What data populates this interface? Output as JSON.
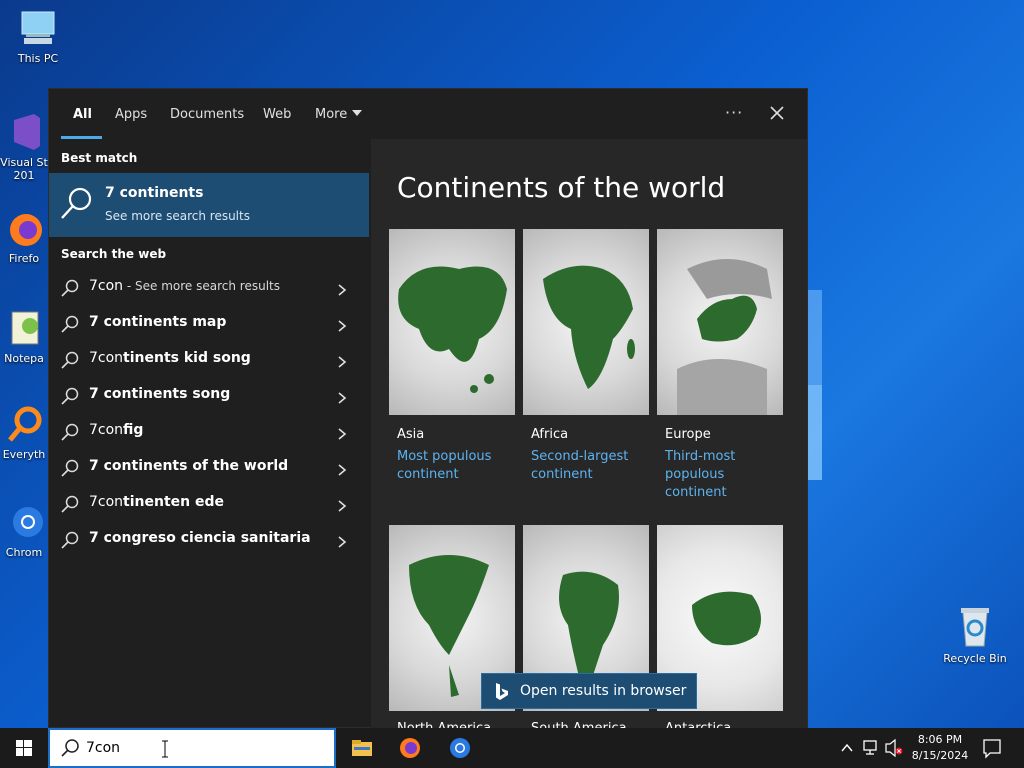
{
  "desktop": {
    "icons": [
      {
        "label": "This PC"
      },
      {
        "label": "Visual St\n201"
      },
      {
        "label": "Firefo"
      },
      {
        "label": "Notepa"
      },
      {
        "label": "Everyth"
      },
      {
        "label": "Chrom"
      }
    ],
    "recycle_bin": "Recycle Bin"
  },
  "search_panel": {
    "tabs": [
      "All",
      "Apps",
      "Documents",
      "Web",
      "More"
    ],
    "active_tab": "All",
    "more_options_icon": "ellipsis-icon",
    "close_icon": "close-icon",
    "best_match_label": "Best match",
    "best_match": {
      "title": "7 continents",
      "subtitle": "See more search results"
    },
    "search_web_label": "Search the web",
    "web_results": [
      {
        "prefix": "7con",
        "bold": "",
        "suffix": " - See more search results"
      },
      {
        "prefix": "7 continents map",
        "bold": "",
        "suffix": ""
      },
      {
        "prefix": "7con",
        "bold": "tinents kid song",
        "suffix": ""
      },
      {
        "prefix": "7 continents song",
        "bold": "",
        "suffix": ""
      },
      {
        "prefix": "7con",
        "bold": "fig",
        "suffix": ""
      },
      {
        "prefix": "7 continents of the world",
        "bold": "",
        "suffix": ""
      },
      {
        "prefix": "7con",
        "bold": "tinenten ede",
        "suffix": ""
      },
      {
        "prefix": "7 congreso ciencia sanitaria",
        "bold": "",
        "suffix": ""
      }
    ],
    "preview": {
      "title": "Continents of the world",
      "cards": [
        {
          "name": "Asia",
          "desc": "Most populous continent"
        },
        {
          "name": "Africa",
          "desc": "Second-largest continent"
        },
        {
          "name": "Europe",
          "desc": "Third-most populous continent"
        },
        {
          "name": "North America",
          "desc": ""
        },
        {
          "name": "South America",
          "desc": ""
        },
        {
          "name": "Antarctica",
          "desc": ""
        }
      ],
      "open_button": "Open results in browser"
    }
  },
  "taskbar": {
    "search_value": "7con",
    "time": "8:06 PM",
    "date": "8/15/2024"
  },
  "colors": {
    "accent": "#1e4d73",
    "link": "#5db3f0",
    "tab_underline": "#4fa8e8"
  }
}
